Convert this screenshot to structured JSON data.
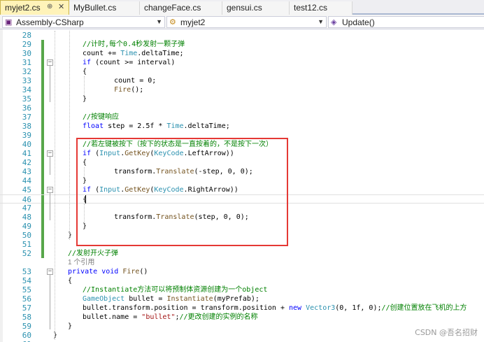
{
  "tabs": [
    {
      "label": "myjet2.cs",
      "active": true,
      "pin": "⊕",
      "close": "✕"
    },
    {
      "label": "MyBullet.cs"
    },
    {
      "label": "changeFace.cs"
    },
    {
      "label": "gensui.cs"
    },
    {
      "label": "test12.cs"
    }
  ],
  "navbar": {
    "project": "Assembly-CSharp",
    "class": "myjet2",
    "member": "Update()"
  },
  "editor": {
    "lines": [
      {
        "num": "28",
        "code": []
      },
      {
        "num": "29",
        "code": [
          {
            "t": "//计时,每个0.4秒发射一颗子弹",
            "c": "c"
          }
        ]
      },
      {
        "num": "30",
        "code": [
          {
            "t": "count += "
          },
          {
            "t": "Time",
            "c": "t"
          },
          {
            "t": ".deltaTime;"
          }
        ]
      },
      {
        "num": "31",
        "code": [
          {
            "t": "if",
            "c": "k"
          },
          {
            "t": " (count >= interval)"
          }
        ]
      },
      {
        "num": "32",
        "code": [
          {
            "t": "{"
          }
        ]
      },
      {
        "num": "33",
        "code": [
          {
            "t": "    count = 0;"
          }
        ]
      },
      {
        "num": "34",
        "code": [
          {
            "t": "    "
          },
          {
            "t": "Fire",
            "c": "m"
          },
          {
            "t": "();"
          }
        ]
      },
      {
        "num": "35",
        "code": [
          {
            "t": "}"
          }
        ]
      },
      {
        "num": "36",
        "code": []
      },
      {
        "num": "37",
        "code": [
          {
            "t": "//按键响应",
            "c": "c"
          }
        ]
      },
      {
        "num": "38",
        "code": [
          {
            "t": "float",
            "c": "k"
          },
          {
            "t": " step = 2.5f * "
          },
          {
            "t": "Time",
            "c": "t"
          },
          {
            "t": ".deltaTime;"
          }
        ]
      },
      {
        "num": "39",
        "code": []
      },
      {
        "num": "40",
        "code": [
          {
            "t": "//若左键被按下（按下的状态是一直按着的，不是按下一次）",
            "c": "c"
          }
        ]
      },
      {
        "num": "41",
        "code": [
          {
            "t": "if",
            "c": "k"
          },
          {
            "t": " ("
          },
          {
            "t": "Input",
            "c": "t"
          },
          {
            "t": "."
          },
          {
            "t": "GetKey",
            "c": "m"
          },
          {
            "t": "("
          },
          {
            "t": "KeyCode",
            "c": "t"
          },
          {
            "t": ".LeftArrow))"
          }
        ]
      },
      {
        "num": "42",
        "code": [
          {
            "t": "{"
          }
        ]
      },
      {
        "num": "43",
        "code": [
          {
            "t": "    transform."
          },
          {
            "t": "Translate",
            "c": "m"
          },
          {
            "t": "(-step, 0, 0);"
          }
        ]
      },
      {
        "num": "44",
        "code": [
          {
            "t": "}"
          }
        ]
      },
      {
        "num": "45",
        "code": [
          {
            "t": "if",
            "c": "k"
          },
          {
            "t": " ("
          },
          {
            "t": "Input",
            "c": "t"
          },
          {
            "t": "."
          },
          {
            "t": "GetKey",
            "c": "m"
          },
          {
            "t": "("
          },
          {
            "t": "KeyCode",
            "c": "t"
          },
          {
            "t": ".RightArrow))"
          }
        ]
      },
      {
        "num": "46",
        "code": [
          {
            "t": "{"
          }
        ]
      },
      {
        "num": "47",
        "code": []
      },
      {
        "num": "48",
        "code": [
          {
            "t": "    transform."
          },
          {
            "t": "Translate",
            "c": "m"
          },
          {
            "t": "(step, 0, 0);"
          }
        ]
      },
      {
        "num": "49",
        "code": [
          {
            "t": "}"
          }
        ]
      },
      {
        "num": "50",
        "code": [
          {
            "t": "}"
          }
        ]
      },
      {
        "num": "51",
        "code": []
      },
      {
        "num": "52",
        "code": [
          {
            "t": "//发射开火子弹",
            "c": "c"
          }
        ]
      },
      {
        "num": "",
        "code": [
          {
            "t": "1 个引用",
            "c": "r"
          }
        ]
      },
      {
        "num": "53",
        "code": [
          {
            "t": "private",
            "c": "k"
          },
          {
            "t": " "
          },
          {
            "t": "void",
            "c": "k"
          },
          {
            "t": " "
          },
          {
            "t": "Fire",
            "c": "m"
          },
          {
            "t": "()"
          }
        ]
      },
      {
        "num": "54",
        "code": [
          {
            "t": "{"
          }
        ]
      },
      {
        "num": "55",
        "code": [
          {
            "t": "//Instantiate方法可以将预制体资源创建为一个object",
            "c": "c"
          }
        ]
      },
      {
        "num": "56",
        "code": [
          {
            "t": "GameObject",
            "c": "t"
          },
          {
            "t": " bullet = "
          },
          {
            "t": "Instantiate",
            "c": "m"
          },
          {
            "t": "(myPrefab);"
          }
        ]
      },
      {
        "num": "57",
        "code": [
          {
            "t": "bullet.transform.position = transform.position + "
          },
          {
            "t": "new",
            "c": "k"
          },
          {
            "t": " "
          },
          {
            "t": "Vector3",
            "c": "t"
          },
          {
            "t": "(0, 1f, 0);"
          },
          {
            "t": "//创建位置放在飞机的上方",
            "c": "c"
          }
        ]
      },
      {
        "num": "58",
        "code": [
          {
            "t": "bullet.name = "
          },
          {
            "t": "\"bullet\"",
            "c": "s"
          },
          {
            "t": ";"
          },
          {
            "t": "//更改创建的实例的名称",
            "c": "c"
          }
        ]
      },
      {
        "num": "59",
        "code": [
          {
            "t": "}"
          }
        ]
      },
      {
        "num": "60",
        "code": [
          {
            "t": "}"
          }
        ]
      },
      {
        "num": "61",
        "code": []
      }
    ]
  },
  "watermark": "CSDN @吾名招财",
  "colors": {
    "keyword": "#0000ff",
    "type": "#2b91af",
    "comment": "#008000",
    "string": "#a31515",
    "method": "#74531f",
    "highlight": "#e53935",
    "change_bar": "#57a64a"
  }
}
